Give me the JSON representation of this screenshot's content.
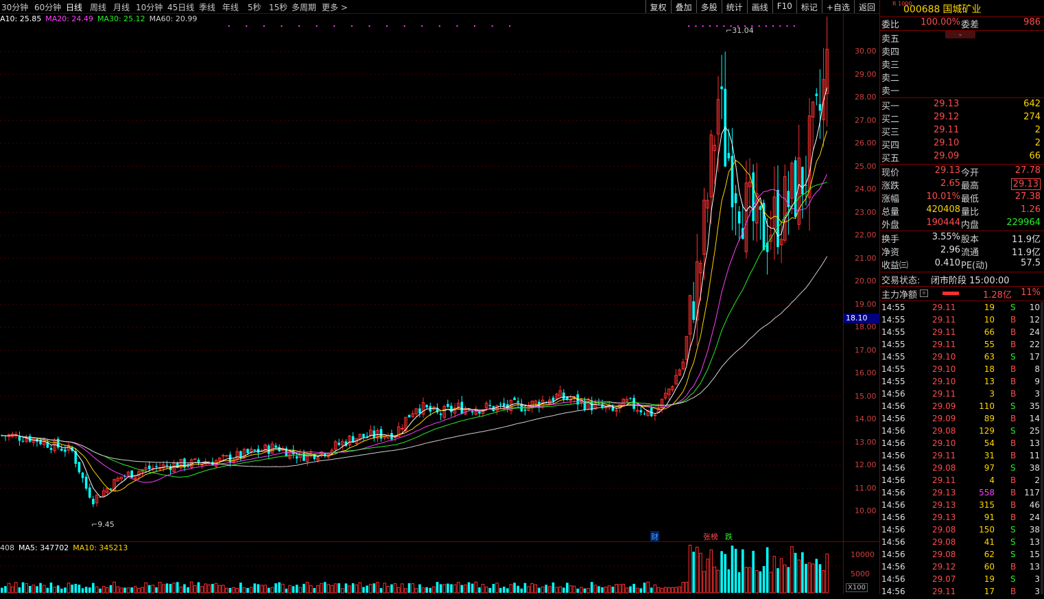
{
  "toolbar": {
    "periods": [
      "30分钟",
      "60分钟",
      "日线",
      "周线",
      "月线",
      "10分钟",
      "45日线",
      "季线",
      "年线",
      "5秒",
      "15秒",
      "多周期",
      "更多 >"
    ],
    "active_period": "日线",
    "right_buttons": [
      "复权",
      "叠加",
      "多股",
      "统计",
      "画线",
      "F10",
      "标记",
      "+自选",
      "返回"
    ]
  },
  "ma_legend": [
    {
      "label": "A10: 25.85",
      "color": "#ffffff"
    },
    {
      "label": "MA20: 24.49",
      "color": "#ff40ff"
    },
    {
      "label": "MA30: 25.12",
      "color": "#27f027"
    },
    {
      "label": "MA60: 20.99",
      "color": "#d0d0d0"
    }
  ],
  "vol_legend": [
    {
      "label": "408",
      "color": "#d0d0d0"
    },
    {
      "label": "MA5: 347702",
      "color": "#ffffff"
    },
    {
      "label": "MA10: 345213",
      "color": "#ffd700"
    }
  ],
  "y_ticks": [
    "30.00",
    "29.00",
    "28.00",
    "27.00",
    "26.00",
    "25.00",
    "24.00",
    "23.00",
    "22.00",
    "21.00",
    "20.00",
    "19.00",
    "18.00",
    "17.00",
    "16.00",
    "15.00",
    "14.00",
    "13.00",
    "12.00",
    "11.00",
    "10.00"
  ],
  "vol_ticks": [
    "10000",
    "5000"
  ],
  "current_price_tag": "18.10",
  "vol_unit": "X100",
  "annotations": {
    "high": "31.04",
    "low": "9.45"
  },
  "event_marks": [
    {
      "text": "财",
      "color": "#4aa0ff"
    },
    {
      "text": "张榜",
      "color": "#ff4c4c"
    },
    {
      "text": "跌",
      "color": "#27f027"
    }
  ],
  "stock": {
    "r_badge": "R 1000",
    "code": "000688",
    "name": "国城矿业"
  },
  "order_book": {
    "weibi_label": "委比",
    "weibi_value": "100.00%",
    "weicha_label": "委差",
    "weicha_value": "986",
    "sells": [
      {
        "label": "卖五"
      },
      {
        "label": "卖四"
      },
      {
        "label": "卖三"
      },
      {
        "label": "卖二"
      },
      {
        "label": "卖一"
      }
    ],
    "buys": [
      {
        "label": "买一",
        "price": "29.13",
        "vol": "642"
      },
      {
        "label": "买二",
        "price": "29.12",
        "vol": "274"
      },
      {
        "label": "买三",
        "price": "29.11",
        "vol": "2"
      },
      {
        "label": "买四",
        "price": "29.10",
        "vol": "2"
      },
      {
        "label": "买五",
        "price": "29.09",
        "vol": "66"
      }
    ]
  },
  "quote": [
    {
      "l": "现价",
      "v": "29.13",
      "vc": "red",
      "l2": "今开",
      "v2": "27.78",
      "v2c": "red"
    },
    {
      "l": "涨跌",
      "v": "2.65",
      "vc": "red",
      "l2": "最高",
      "v2": "29.13",
      "v2c": "red"
    },
    {
      "l": "涨幅",
      "v": "10.01%",
      "vc": "red",
      "l2": "最低",
      "v2": "27.38",
      "v2c": "red"
    },
    {
      "l": "总量",
      "v": "420408",
      "vc": "yellow",
      "l2": "量比",
      "v2": "1.26",
      "v2c": "red"
    },
    {
      "l": "外盘",
      "v": "190444",
      "vc": "red",
      "l2": "内盘",
      "v2": "229964",
      "v2c": "green"
    }
  ],
  "fundamentals": [
    {
      "l": "换手",
      "v": "3.55%",
      "l2": "股本",
      "v2": "11.9亿"
    },
    {
      "l": "净资",
      "v": "2.96",
      "l2": "流通",
      "v2": "11.9亿"
    },
    {
      "l": "收益㈢",
      "v": "0.410",
      "l2": "PE(动)",
      "v2": "57.5"
    }
  ],
  "trade_status": {
    "label": "交易状态:",
    "value": "闭市阶段 15:00:00"
  },
  "main_force": {
    "label": "主力净额",
    "value": "1.28亿",
    "pct": "11%"
  },
  "ticks": [
    {
      "t": "14:55",
      "p": "29.11",
      "v": "19",
      "s": "S",
      "n": "10"
    },
    {
      "t": "14:55",
      "p": "29.11",
      "v": "10",
      "s": "B",
      "n": "12"
    },
    {
      "t": "14:55",
      "p": "29.11",
      "v": "66",
      "s": "B",
      "n": "24"
    },
    {
      "t": "14:55",
      "p": "29.11",
      "v": "55",
      "s": "B",
      "n": "22"
    },
    {
      "t": "14:55",
      "p": "29.10",
      "v": "63",
      "s": "S",
      "n": "17"
    },
    {
      "t": "14:55",
      "p": "29.10",
      "v": "18",
      "s": "B",
      "n": "8"
    },
    {
      "t": "14:55",
      "p": "29.10",
      "v": "13",
      "s": "B",
      "n": "9"
    },
    {
      "t": "14:56",
      "p": "29.11",
      "v": "3",
      "s": "B",
      "n": "3"
    },
    {
      "t": "14:56",
      "p": "29.09",
      "v": "110",
      "s": "S",
      "n": "35"
    },
    {
      "t": "14:56",
      "p": "29.09",
      "v": "89",
      "s": "B",
      "n": "14"
    },
    {
      "t": "14:56",
      "p": "29.08",
      "v": "129",
      "s": "S",
      "n": "25"
    },
    {
      "t": "14:56",
      "p": "29.10",
      "v": "54",
      "s": "B",
      "n": "13"
    },
    {
      "t": "14:56",
      "p": "29.11",
      "v": "31",
      "s": "B",
      "n": "11"
    },
    {
      "t": "14:56",
      "p": "29.08",
      "v": "97",
      "s": "S",
      "n": "38"
    },
    {
      "t": "14:56",
      "p": "29.11",
      "v": "4",
      "s": "B",
      "n": "2"
    },
    {
      "t": "14:56",
      "p": "29.13",
      "v": "558",
      "s": "B",
      "n": "117"
    },
    {
      "t": "14:56",
      "p": "29.13",
      "v": "315",
      "s": "B",
      "n": "46"
    },
    {
      "t": "14:56",
      "p": "29.13",
      "v": "91",
      "s": "B",
      "n": "24"
    },
    {
      "t": "14:56",
      "p": "29.08",
      "v": "150",
      "s": "S",
      "n": "38"
    },
    {
      "t": "14:56",
      "p": "29.08",
      "v": "41",
      "s": "S",
      "n": "13"
    },
    {
      "t": "14:56",
      "p": "29.08",
      "v": "62",
      "s": "S",
      "n": "15"
    },
    {
      "t": "14:56",
      "p": "29.12",
      "v": "60",
      "s": "B",
      "n": "13"
    },
    {
      "t": "14:56",
      "p": "29.07",
      "v": "19",
      "s": "S",
      "n": "3"
    },
    {
      "t": "14:56",
      "p": "29.11",
      "v": "17",
      "s": "B",
      "n": "3"
    }
  ],
  "chart_data": {
    "type": "candlestick",
    "title": "",
    "ylim": [
      9,
      31
    ],
    "price_anchors": [
      [
        0,
        13.3
      ],
      [
        8,
        13.2
      ],
      [
        14,
        12.9
      ],
      [
        20,
        12.6
      ],
      [
        24,
        11.0
      ],
      [
        26,
        10.5
      ],
      [
        30,
        11.0
      ],
      [
        34,
        11.5
      ],
      [
        40,
        11.8
      ],
      [
        48,
        12.0
      ],
      [
        56,
        12.1
      ],
      [
        62,
        12.2
      ],
      [
        70,
        12.5
      ],
      [
        78,
        12.8
      ],
      [
        85,
        12.4
      ],
      [
        92,
        12.6
      ],
      [
        100,
        13.2
      ],
      [
        106,
        13.3
      ],
      [
        112,
        13.4
      ],
      [
        118,
        14.6
      ],
      [
        124,
        14.2
      ],
      [
        130,
        14.5
      ],
      [
        140,
        14.5
      ],
      [
        150,
        14.6
      ],
      [
        158,
        15.0
      ],
      [
        166,
        14.7
      ],
      [
        174,
        14.3
      ],
      [
        178,
        14.7
      ],
      [
        186,
        14.2
      ],
      [
        190,
        15.3
      ],
      [
        194,
        16.5
      ],
      [
        196,
        18.5
      ],
      [
        199,
        21.0
      ],
      [
        202,
        25.0
      ],
      [
        204,
        28.0
      ],
      [
        206,
        26.0
      ],
      [
        208,
        25.0
      ],
      [
        212,
        23.0
      ],
      [
        216,
        22.0
      ],
      [
        222,
        23.0
      ],
      [
        228,
        24.5
      ],
      [
        232,
        26.5
      ],
      [
        235,
        29.13
      ]
    ],
    "ma": {
      "A10": 25.85,
      "MA20": 24.49,
      "MA30": 25.12,
      "MA60": 20.99
    },
    "volume_ticks": [
      10000,
      5000
    ]
  }
}
